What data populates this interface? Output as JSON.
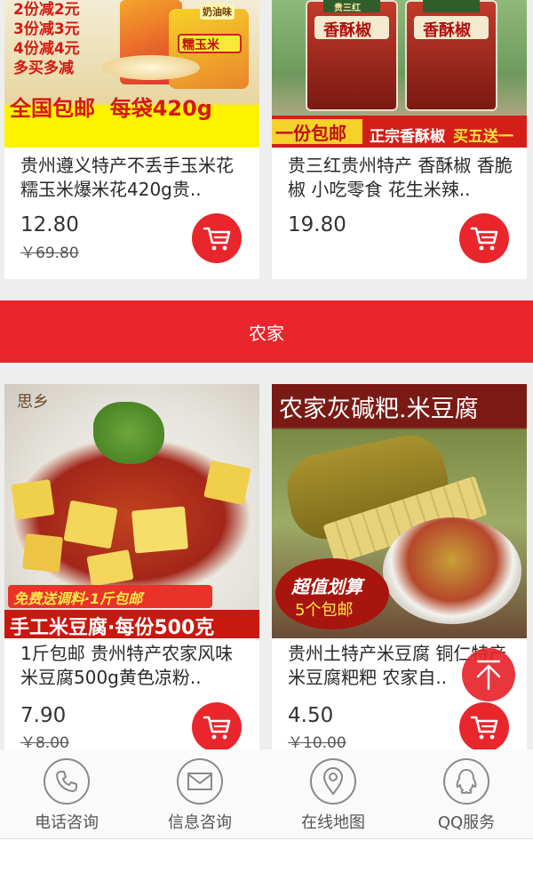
{
  "colors": {
    "accent": "#e8262c",
    "background": "#eeeeee"
  },
  "section": {
    "label": "农家"
  },
  "products_top": [
    {
      "title": "贵州遵义特产不丢手玉米花糯玉米爆米花420g贵..",
      "price": "12.80",
      "original_price": "￥69.80",
      "promo": {
        "lines": [
          "2份减2元",
          "3份减3元",
          "4份减4元",
          "多买多减"
        ],
        "banner": "全国包邮  每袋420g",
        "bag_label": "糯玉米",
        "bag_tag": "奶油味"
      }
    },
    {
      "title": "贵三红贵州特产 香酥椒 香脆椒 小吃零食 花生米辣..",
      "price": "19.80",
      "original_price": "",
      "promo": {
        "jar_label": "香酥椒",
        "jar_brand": "贵三红",
        "banner_left": "一份包邮",
        "banner_right_a": "正宗香酥椒",
        "banner_right_b": "买五送一"
      }
    }
  ],
  "products_bottom": [
    {
      "title": "1斤包邮 贵州特产农家风味米豆腐500g黄色凉粉..",
      "price": "7.90",
      "original_price": "￥8.00",
      "promo": {
        "brand": "思乡",
        "line1": "免费送调料·1斤包邮",
        "line2": "手工米豆腐·每份500克"
      }
    },
    {
      "title": "贵州土特产米豆腐 铜仁特产米豆腐粑粑 农家自..",
      "price": "4.50",
      "original_price": "￥10.00",
      "promo": {
        "header": "农家灰碱粑.米豆腐",
        "badge_line1": "超值划算",
        "badge_line2": "5个包邮"
      }
    }
  ],
  "icons": {
    "cart": "shopping-cart-icon",
    "back_top": "arrow-up-icon",
    "phone": "phone-icon",
    "message": "envelope-icon",
    "map": "map-pin-icon",
    "qq": "qq-penguin-icon"
  },
  "bottom_nav": [
    {
      "label": "电话咨询"
    },
    {
      "label": "信息咨询"
    },
    {
      "label": "在线地图"
    },
    {
      "label": "QQ服务"
    }
  ]
}
